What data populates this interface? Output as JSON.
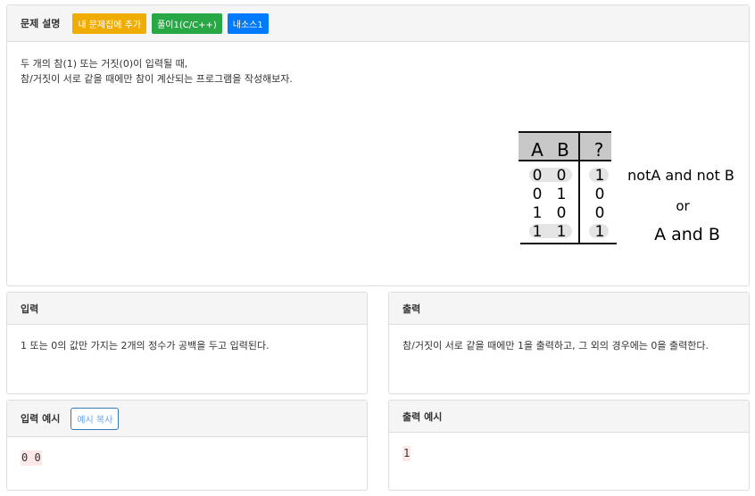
{
  "description": {
    "title": "문제 설명",
    "buttons": [
      {
        "label": "내 문제집에 추가",
        "color": "#f0ad00"
      },
      {
        "label": "풀이1(C/C++)",
        "color": "#28a745"
      },
      {
        "label": "내소스1",
        "color": "#007bff"
      }
    ],
    "lines": [
      "두 개의 참(1) 또는 거짓(0)이 입력될 때,",
      "참/거짓이 서로 같을 때에만 참이 계산되는 프로그램을 작성해보자."
    ],
    "image": {
      "header": [
        "A",
        "B",
        "?"
      ],
      "rows": [
        [
          "0",
          "0",
          "1"
        ],
        [
          "0",
          "1",
          "0"
        ],
        [
          "1",
          "0",
          "0"
        ],
        [
          "1",
          "1",
          "1"
        ]
      ],
      "note1": "notA and not B",
      "note2": "or",
      "note3": "A and B"
    }
  },
  "input": {
    "title": "입력",
    "text": "1 또는 0의 값만 가지는 2개의 정수가 공백을 두고 입력된다."
  },
  "output": {
    "title": "출력",
    "text": "참/거짓이 서로 같을 때에만 1을 출력하고, 그 외의 경우에는 0을 출력한다."
  },
  "sample_input": {
    "title": "입력 예시",
    "copy_label": "예시 복사",
    "value": "0 0"
  },
  "sample_output": {
    "title": "출력 예시",
    "value": "1"
  }
}
